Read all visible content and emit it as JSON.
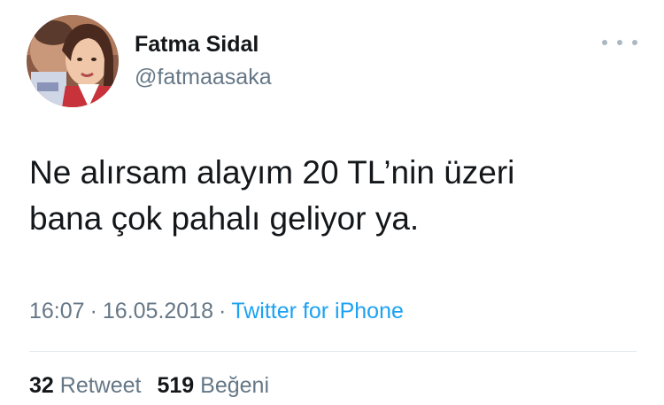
{
  "tweet": {
    "author": {
      "name": "Fatma Sidal",
      "handle": "@fatmaasaka"
    },
    "text_lines": [
      "Ne alırsam alayım 20 TL’nin üzeri",
      "bana çok pahalı geliyor ya."
    ],
    "time": "16:07",
    "date": "16.05.2018",
    "separator": "·",
    "source": "Twitter for iPhone",
    "retweets": {
      "count": "32",
      "label": "Retweet"
    },
    "likes": {
      "count": "519",
      "label": "Beğeni"
    }
  },
  "icons": {
    "more": "more-horizontal-icon"
  },
  "colors": {
    "text_primary": "#14171a",
    "text_secondary": "#657786",
    "link": "#1da1f2",
    "divider": "#e1e8ed"
  }
}
